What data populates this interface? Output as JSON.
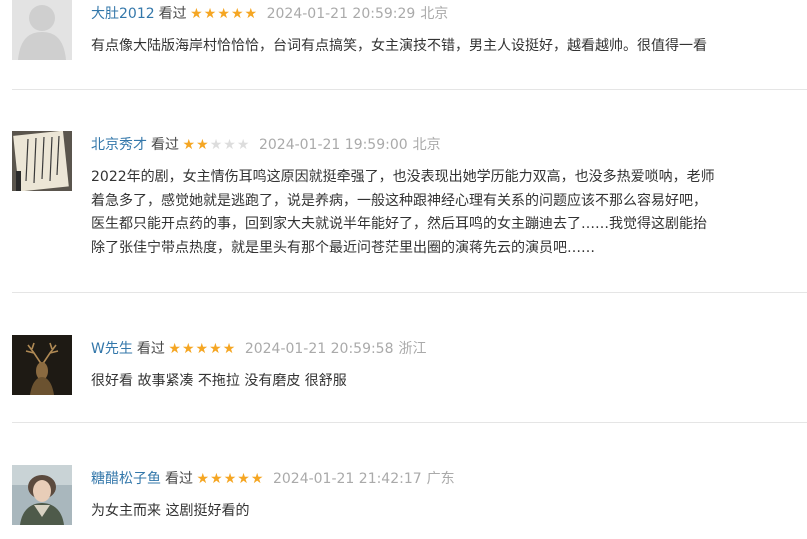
{
  "comments": [
    {
      "user": "大肚2012",
      "status": "看过",
      "rating": 5,
      "time": "2024-01-21 20:59:29",
      "location": "北京",
      "lines": [
        "有点像大陆版海岸村恰恰恰，台词有点搞笑，女主演技不错，男主人设挺好，越看越帅。很值得一看"
      ]
    },
    {
      "user": "北京秀才",
      "status": "看过",
      "rating": 2,
      "time": "2024-01-21 19:59:00",
      "location": "北京",
      "lines": [
        "2022年的剧，女主情伤耳鸣这原因就挺牵强了，也没表现出她学历能力双高，也没多热爱唢呐，老师",
        "着急多了，感觉她就是逃跑了，说是养病，一般这种跟神经心理有关系的问题应该不那么容易好吧，",
        "医生都只能开点药的事，回到家大夫就说半年能好了，然后耳鸣的女主蹦迪去了……我觉得这剧能抬",
        "除了张佳宁带点热度，就是里头有那个最近问苍茫里出圈的演蒋先云的演员吧……"
      ]
    },
    {
      "user": "W先生",
      "status": "看过",
      "rating": 5,
      "time": "2024-01-21 20:59:58",
      "location": "浙江",
      "lines": [
        "很好看 故事紧凑 不拖拉 没有磨皮 很舒服"
      ]
    },
    {
      "user": "糖醋松子鱼",
      "status": "看过",
      "rating": 5,
      "time": "2024-01-21 21:42:17",
      "location": "广东",
      "lines": [
        "为女主而来 这剧挺好看的"
      ]
    }
  ]
}
